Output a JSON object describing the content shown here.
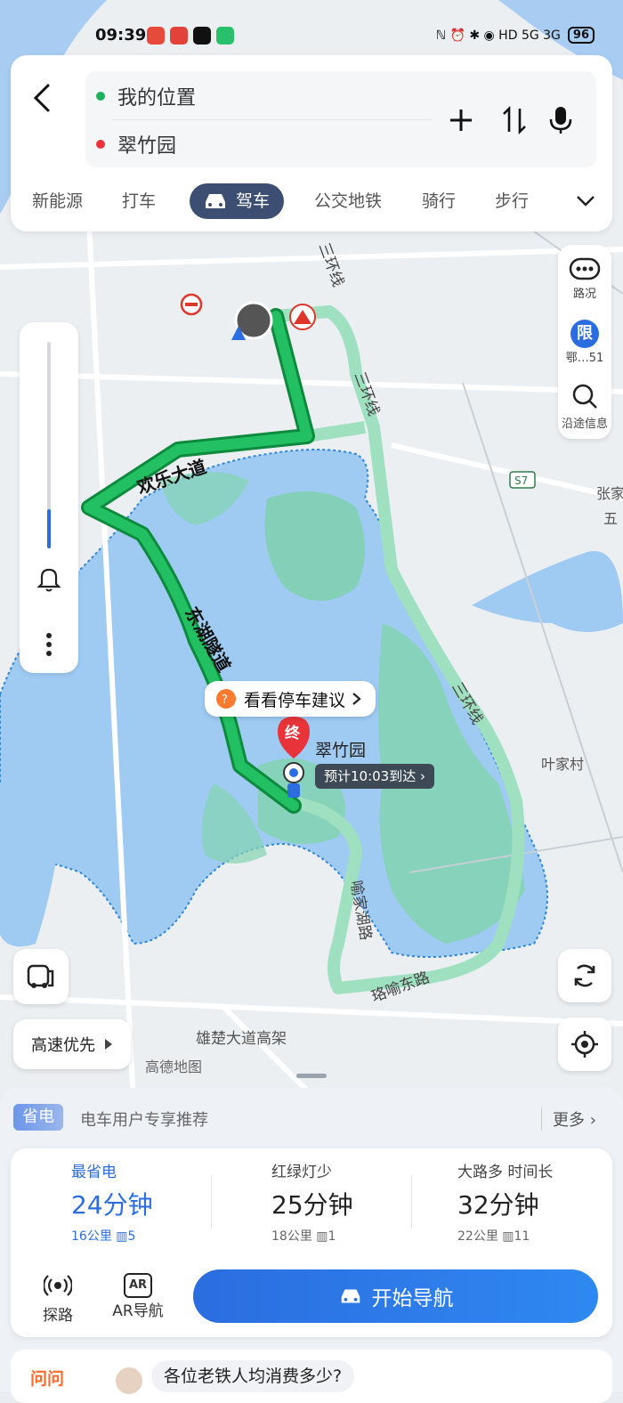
{
  "status_bar": {
    "time": "09:39",
    "right": "ℕ ⏰ ✱ ◉ HD 5G 3G",
    "battery": "96"
  },
  "route_input": {
    "origin": "我的位置",
    "destination": "翠竹园"
  },
  "modes": [
    "新能源",
    "打车",
    "驾车",
    "公交地铁",
    "骑行",
    "步行"
  ],
  "right_tools": {
    "traffic": "路况",
    "restrict_icon": "限",
    "restrict": "鄂…51",
    "along": "沿途信息"
  },
  "map": {
    "roads": {
      "huanle": "欢乐大道",
      "donghu_tunnel": "东湖隧道",
      "third_ring_a": "三环线",
      "third_ring_b": "三环线",
      "third_ring_c": "三环线",
      "yujiahu": "喻家湖路",
      "luoyu_east": "珞喻东路",
      "xiongchu": "雄楚大道高架",
      "s7": "S7",
      "yejiacun": "叶家村",
      "zhang": "张家",
      "wu": "五"
    },
    "destination": "翠竹园",
    "end_tag": "终",
    "eta": "预计10:03到达",
    "parking_bubble": "看看停车建议",
    "watermark": "高德地图"
  },
  "highway_pref": "高速优先",
  "eco_bar": {
    "badge": "省电",
    "text": "电车用户专享推荐",
    "more": "更多"
  },
  "routes": [
    {
      "tag": "最省电",
      "time": "24分钟",
      "distance": "16公里",
      "lights": "5",
      "selected": true
    },
    {
      "tag": "红绿灯少",
      "time": "25分钟",
      "distance": "18公里",
      "lights": "1",
      "selected": false
    },
    {
      "tag": "大路多 时间长",
      "time": "32分钟",
      "distance": "22公里",
      "lights": "11",
      "selected": false
    }
  ],
  "actions": {
    "explore": "探路",
    "ar": "AR导航",
    "ar_icon": "AR",
    "start": "开始导航"
  },
  "ask": {
    "badge": "问问",
    "question": "各位老铁人均消费多少?"
  },
  "colors": {
    "accent": "#2b6de0",
    "route_green": "#1fb15a",
    "route_alt": "#8fdcb4",
    "lake": "#a5cdf5",
    "park": "#8fd6b4"
  }
}
